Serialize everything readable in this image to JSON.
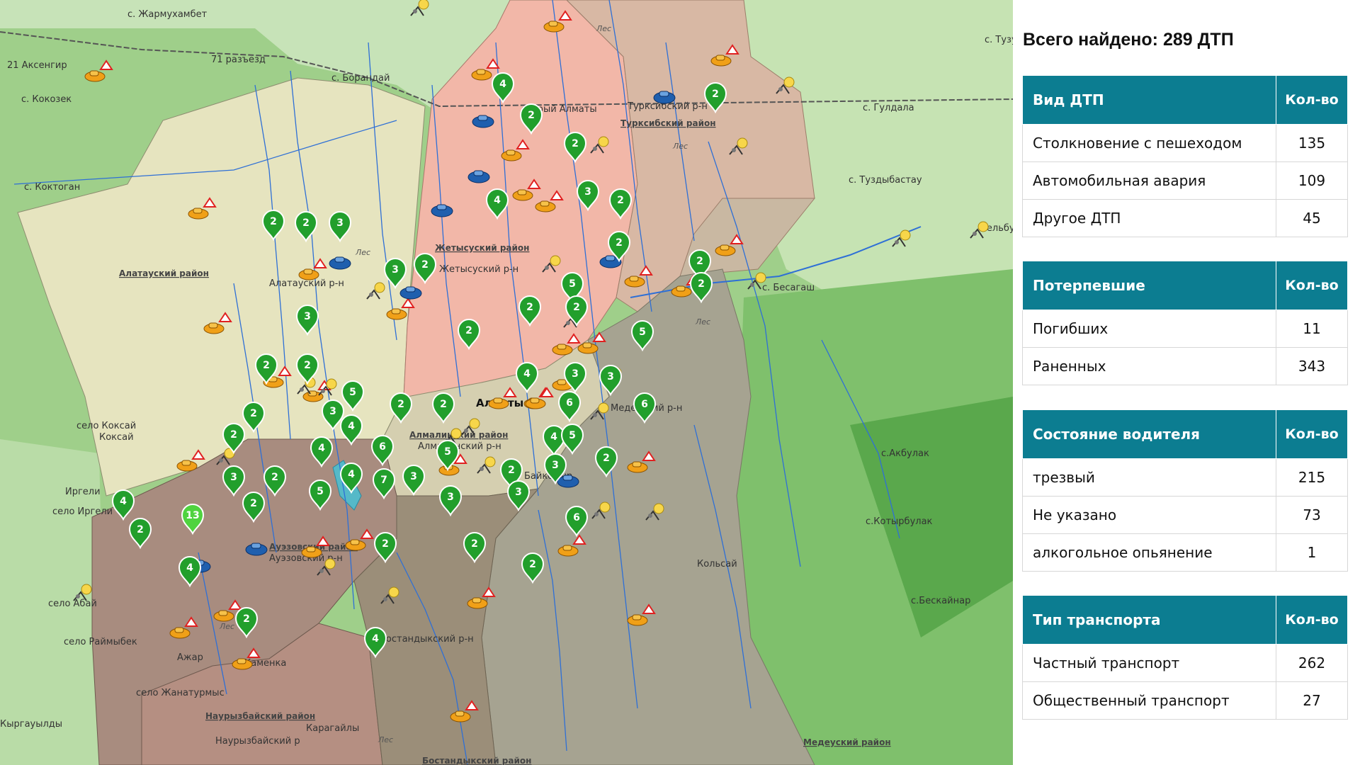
{
  "summary": {
    "total_label": "Всего найдено: 289 ДТП"
  },
  "tables": [
    {
      "title": "Вид ДТП",
      "count_header": "Кол-во",
      "rows": [
        {
          "label": "Столкновение с пешеходом",
          "value": "135"
        },
        {
          "label": "Автомобильная авария",
          "value": "109"
        },
        {
          "label": "Другое ДТП",
          "value": "45"
        }
      ]
    },
    {
      "title": "Потерпевшие",
      "count_header": "Кол-во",
      "rows": [
        {
          "label": "Погибших",
          "value": "11"
        },
        {
          "label": "Раненных",
          "value": "343"
        }
      ]
    },
    {
      "title": "Состояние водителя",
      "count_header": "Кол-во",
      "rows": [
        {
          "label": "трезвый",
          "value": "215"
        },
        {
          "label": "Не указано",
          "value": "73"
        },
        {
          "label": "алкогольное опьянение",
          "value": "1"
        }
      ]
    },
    {
      "title": "Тип транспорта",
      "count_header": "Кол-во",
      "rows": [
        {
          "label": "Частный транспорт",
          "value": "262"
        },
        {
          "label": "Общественный транспорт",
          "value": "27"
        }
      ]
    }
  ],
  "map": {
    "city_label": "Алматы",
    "places": [
      "с. Жармухамбет",
      "21 Аксенгир",
      "71 разъезд",
      "с. Борандай",
      "с. Кокозек",
      "с. Коктоган",
      "с. Тузу",
      "с. Гулдала",
      "с. Туздыбастау",
      "Бельбулак",
      "с. Бесагаш",
      "Каменка",
      "село Коксай",
      "Коксай",
      "Иргели",
      "село Иргели",
      "село Абай",
      "село Раймыбек",
      "село Жанатурмыс",
      "Кыргауылды",
      "с.Акбулак",
      "с.Котырбулак",
      "с.Бескайнар",
      "Кольсай",
      "Ажар",
      "Карагайлы",
      "старый Алматы",
      "Жетысуский р-н",
      "Алатауский р-н",
      "Медеуский р-н",
      "Алмалинский р-н",
      "Бостандыкский р-н",
      "Наурызбайский р",
      "Ауэзовский р-н",
      "Турксибский р-н",
      "Байконыр"
    ],
    "districts": [
      "Алатауский район",
      "Жетысуский район",
      "Турксибский район",
      "Алмалинский район",
      "Ауэзовский район",
      "Наурызбайский район",
      "Медеуский район",
      "Бостандыкский район"
    ],
    "forest_label": "Лес",
    "cluster_counts": [
      "4",
      "2",
      "2",
      "2",
      "3",
      "2",
      "4",
      "2",
      "2",
      "3",
      "2",
      "5",
      "2",
      "3",
      "2",
      "2",
      "3",
      "2",
      "2",
      "5",
      "2",
      "4",
      "3",
      "3",
      "6",
      "2",
      "2",
      "6",
      "3",
      "2",
      "2",
      "2",
      "2",
      "5",
      "4",
      "2",
      "4",
      "7",
      "6",
      "5",
      "3",
      "3",
      "2",
      "3",
      "5",
      "4",
      "4",
      "5",
      "3",
      "2",
      "2",
      "6",
      "3",
      "13",
      "4",
      "2",
      "2",
      "2",
      "2",
      "4",
      "4",
      "2"
    ],
    "marker_types": {
      "cluster": "green-cluster-pin-icon",
      "collision": "car-crash-icon",
      "pedestrian": "pedestrian-hit-icon",
      "car": "blue-car-icon"
    },
    "colors": {
      "alatau": "#e6e4bf",
      "zhetysu": "#f2b7a8",
      "turksib": "#d8b8a4",
      "auezov": "#a88c7f",
      "almaly": "#d5cfb0",
      "medeu": "#a6a391",
      "bostandyk": "#9b8e79",
      "header": "#0c7d91",
      "cluster": "#229f2c"
    }
  }
}
